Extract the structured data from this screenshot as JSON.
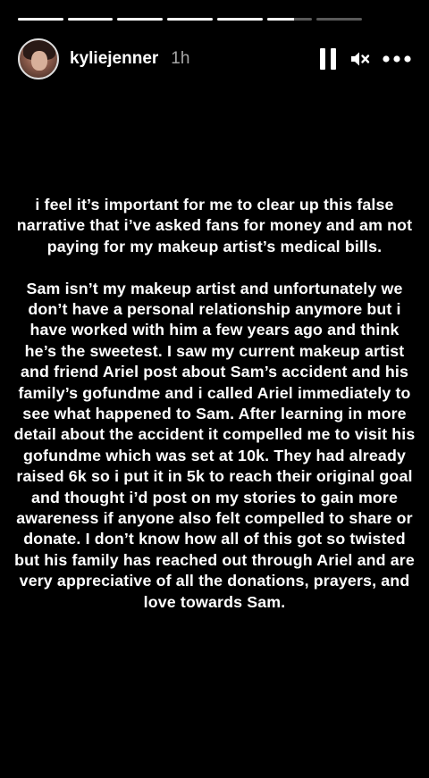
{
  "progress": {
    "segments": [
      1,
      1,
      1,
      1,
      1,
      0.6,
      0
    ]
  },
  "header": {
    "username": "kyliejenner",
    "time": "1h",
    "icons": {
      "pause": "pause-icon",
      "mute": "mute-icon",
      "more": "more-icon"
    }
  },
  "story": {
    "paragraphs": [
      "i feel it’s important for me to clear up this false narrative that i’ve asked fans for money and am not paying for my makeup artist’s medical bills.",
      "Sam isn’t my makeup artist and unfortunately we don’t have a personal relationship anymore but i have worked with him a few years ago and think he’s the sweetest. I saw my current makeup artist and friend Ariel post about Sam’s accident and his family’s gofundme and i called Ariel immediately to see what happened to Sam. After learning in more detail about the accident it compelled me to visit his gofundme which was set at 10k. They had already raised 6k so i put it in 5k to reach their original goal and thought i’d post on my stories to gain more awareness if anyone also felt compelled to share or donate. I don’t know how all of this got so twisted but his family has reached out through Ariel and are very appreciative of all the donations, prayers, and love towards Sam."
    ]
  }
}
